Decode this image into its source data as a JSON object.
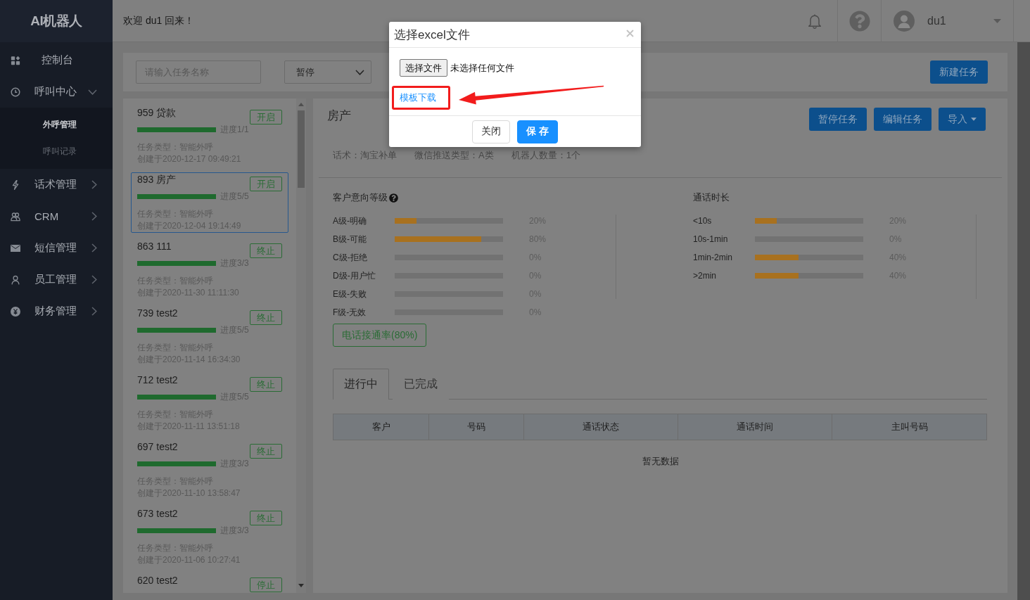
{
  "sidebar": {
    "logo": "AI机器人",
    "items": [
      {
        "label": "控制台",
        "kind": "link"
      },
      {
        "label": "呼叫中心",
        "kind": "group",
        "expanded": true,
        "children": [
          {
            "label": "外呼管理",
            "selected": true
          },
          {
            "label": "呼叫记录",
            "selected": false
          }
        ]
      },
      {
        "label": "话术管理",
        "kind": "group",
        "expanded": false
      },
      {
        "label": "CRM",
        "kind": "group",
        "expanded": false
      },
      {
        "label": "短信管理",
        "kind": "group",
        "expanded": false
      },
      {
        "label": "员工管理",
        "kind": "group",
        "expanded": false
      },
      {
        "label": "财务管理",
        "kind": "group",
        "expanded": false
      }
    ]
  },
  "header": {
    "welcome": "欢迎 du1 回来！",
    "user": "du1"
  },
  "toolbar": {
    "search": {
      "placeholder": "请输入任务名称"
    },
    "status_select": {
      "value": "暂停"
    },
    "new_task_button": "新建任务"
  },
  "tasks": [
    {
      "title": "959 贷款",
      "status": "开启",
      "level": 1,
      "progress": "进度1/1",
      "type": "任务类型：智能外呼",
      "created": "创建于2020-12-17 09:49:21",
      "selected": false
    },
    {
      "title": "893 房产",
      "status": "开启",
      "level": 1,
      "progress": "进度5/5",
      "type": "任务类型：智能外呼",
      "created": "创建于2020-12-04 19:14:49",
      "selected": true
    },
    {
      "title": "863 111",
      "status": "终止",
      "level": 1,
      "progress": "进度3/3",
      "type": "任务类型：智能外呼",
      "created": "创建于2020-11-30 11:11:30",
      "selected": false
    },
    {
      "title": "739 test2",
      "status": "终止",
      "level": 1,
      "progress": "进度5/5",
      "type": "任务类型：智能外呼",
      "created": "创建于2020-11-14 16:34:30",
      "selected": false
    },
    {
      "title": "712 test2",
      "status": "终止",
      "level": 1,
      "progress": "进度5/5",
      "type": "任务类型：智能外呼",
      "created": "创建于2020-11-11 13:51:18",
      "selected": false
    },
    {
      "title": "697 test2",
      "status": "终止",
      "level": 1,
      "progress": "进度3/3",
      "type": "任务类型：智能外呼",
      "created": "创建于2020-11-10 13:58:47",
      "selected": false
    },
    {
      "title": "673 test2",
      "status": "终止",
      "level": 1,
      "progress": "进度3/3",
      "type": "任务类型：智能外呼",
      "created": "创建于2020-11-06 10:27:41",
      "selected": false
    },
    {
      "title": "620 test2",
      "status": "停止",
      "selected": false
    }
  ],
  "detail": {
    "title": "房产",
    "buttons": [
      {
        "label": "暂停任务",
        "kind": "button"
      },
      {
        "label": "编辑任务",
        "kind": "button"
      },
      {
        "label": "导入",
        "kind": "dropdown"
      }
    ],
    "info": [
      "话术：淘宝补单",
      "微信推送类型：A类",
      "机器人数量：1个"
    ],
    "intent": {
      "title": "客户意向等级",
      "help": true,
      "rows": [
        {
          "label": "A级-明确",
          "level": 0.2,
          "reading": "20%"
        },
        {
          "label": "B级-可能",
          "level": 0.8,
          "reading": "80%"
        },
        {
          "label": "C级-拒绝",
          "level": 0,
          "reading": "0%"
        },
        {
          "label": "D级-用户忙",
          "level": 0,
          "reading": "0%"
        },
        {
          "label": "E级-失败",
          "level": 0,
          "reading": "0%"
        },
        {
          "label": "F级-无效",
          "level": 0,
          "reading": "0%"
        }
      ]
    },
    "duration": {
      "title": "通话时长",
      "rows": [
        {
          "label": "<10s",
          "level": 0.2,
          "reading": "20%"
        },
        {
          "label": "10s-1min",
          "level": 0,
          "reading": "0%"
        },
        {
          "label": "1min-2min",
          "level": 0.4,
          "reading": "40%"
        },
        {
          "label": ">2min",
          "level": 0.4,
          "reading": "40%"
        }
      ]
    },
    "connect_rate": "电话接通率(80%)",
    "tabs": [
      {
        "label": "进行中",
        "selected": true
      },
      {
        "label": "已完成",
        "selected": false
      }
    ],
    "table": {
      "columns": [
        "客户",
        "号码",
        "通话状态",
        "通话时间",
        "主叫号码"
      ],
      "empty_text": "暂无数据"
    }
  },
  "dialog": {
    "title": "选择excel文件",
    "file_button": "选择文件",
    "file_status": "未选择任何文件",
    "template_link": "模板下载",
    "buttons": [
      {
        "label": "关闭",
        "kind": "default"
      },
      {
        "label": "保 存",
        "kind": "primary"
      }
    ]
  }
}
